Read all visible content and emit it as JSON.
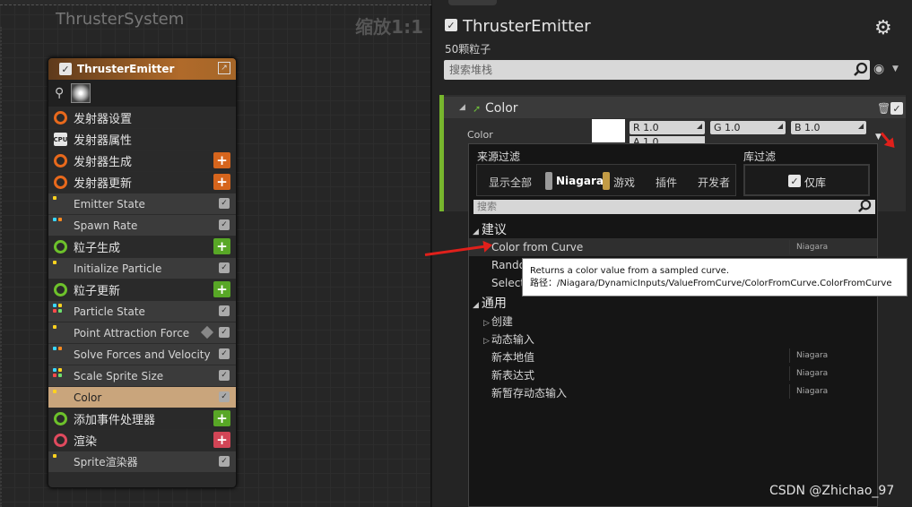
{
  "graph": {
    "title": "ThrusterSystem",
    "zoom": "缩放1:1"
  },
  "emitter_node": {
    "title": "ThrusterEmitter",
    "rows": [
      {
        "label": "发射器设置",
        "kind": "section",
        "icon_color": "#e8691c"
      },
      {
        "label": "发射器属性",
        "kind": "section",
        "icon": "cpu-icon"
      },
      {
        "label": "发射器生成",
        "kind": "section",
        "icon_color": "#e8691c",
        "add_color": "#d6651d"
      },
      {
        "label": "发射器更新",
        "kind": "section",
        "icon_color": "#e8691c",
        "add_color": "#d6651d"
      },
      {
        "label": "Emitter State",
        "kind": "module"
      },
      {
        "label": "Spawn Rate",
        "kind": "module"
      },
      {
        "label": "粒子生成",
        "kind": "section",
        "icon_color": "#6dc12b",
        "add_color": "#58a726"
      },
      {
        "label": "Initialize Particle",
        "kind": "module"
      },
      {
        "label": "粒子更新",
        "kind": "section",
        "icon_color": "#6dc12b",
        "add_color": "#58a726"
      },
      {
        "label": "Particle State",
        "kind": "module"
      },
      {
        "label": "Point Attraction Force",
        "kind": "module"
      },
      {
        "label": "Solve Forces and Velocity",
        "kind": "module"
      },
      {
        "label": "Scale Sprite Size",
        "kind": "module"
      },
      {
        "label": "Color",
        "kind": "module",
        "selected": true
      },
      {
        "label": "添加事件处理器",
        "kind": "section",
        "icon_color": "#6dc12b",
        "add_color": "#58a726"
      },
      {
        "label": "渲染",
        "kind": "section",
        "icon_color": "#e04a5e",
        "add_color": "#d24556"
      },
      {
        "label": "Sprite渲染器",
        "kind": "module",
        "icon": "sprite-icon"
      }
    ]
  },
  "details": {
    "title": "ThrusterEmitter",
    "particle_count": "50颗粒子",
    "search_placeholder": "搜索堆栈",
    "module": {
      "title": "Color",
      "label": "Color",
      "r": "R  1.0",
      "g": "G  1.0",
      "b": "B  1.0",
      "a": "A  1.0"
    }
  },
  "popup": {
    "source_filter_label": "来源过滤",
    "library_filter_label": "库过滤",
    "source_buttons": [
      "显示全部",
      "Niagara",
      "游戏",
      "插件",
      "开发者"
    ],
    "library_only": "仅库",
    "search_placeholder": "搜索",
    "suggest_category": "建议",
    "suggest_items": [
      {
        "label": "Color from Curve",
        "source": "Niagara"
      },
      {
        "label": "Rando",
        "source": ""
      },
      {
        "label": "Select",
        "source": ""
      }
    ],
    "common_category": "通用",
    "common_subs": [
      "创建",
      "动态输入"
    ],
    "common_items": [
      {
        "label": "新本地值",
        "source": "Niagara"
      },
      {
        "label": "新表达式",
        "source": "Niagara"
      },
      {
        "label": "新暂存动态输入",
        "source": "Niagara"
      }
    ]
  },
  "tooltip": {
    "line1": "Returns a color value from a sampled curve.",
    "line2": "路径：/Niagara/DynamicInputs/ValueFromCurve/ColorFromCurve.ColorFromCurve"
  },
  "watermark": "CSDN @Zhichao_97",
  "colors": {
    "accent_green": "#77b62d",
    "arrow_red": "#e0201b",
    "selected_row": "#c9a57c"
  }
}
